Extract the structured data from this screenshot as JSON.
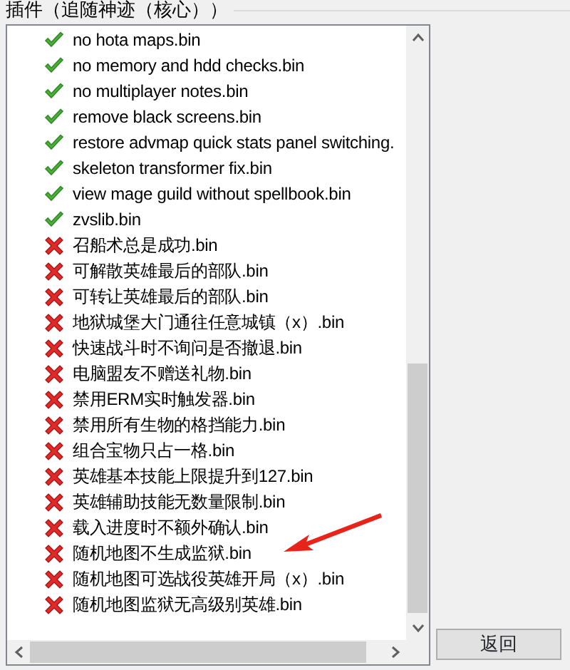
{
  "group_title": "插件（追随神迹（核心））",
  "plugins": [
    {
      "name": "no hota maps.bin",
      "checked": true
    },
    {
      "name": "no memory and hdd checks.bin",
      "checked": true
    },
    {
      "name": "no multiplayer notes.bin",
      "checked": true
    },
    {
      "name": "remove black screens.bin",
      "checked": true
    },
    {
      "name": "restore advmap quick stats panel switching.",
      "checked": true
    },
    {
      "name": "skeleton transformer fix.bin",
      "checked": true
    },
    {
      "name": "view mage guild without spellbook.bin",
      "checked": true
    },
    {
      "name": "zvslib.bin",
      "checked": true
    },
    {
      "name": "召船术总是成功.bin",
      "checked": false
    },
    {
      "name": "可解散英雄最后的部队.bin",
      "checked": false
    },
    {
      "name": "可转让英雄最后的部队.bin",
      "checked": false
    },
    {
      "name": "地狱城堡大门通往任意城镇（x）.bin",
      "checked": false
    },
    {
      "name": "快速战斗时不询问是否撤退.bin",
      "checked": false
    },
    {
      "name": "电脑盟友不赠送礼物.bin",
      "checked": false
    },
    {
      "name": "禁用ERM实时触发器.bin",
      "checked": false
    },
    {
      "name": "禁用所有生物的格挡能力.bin",
      "checked": false
    },
    {
      "name": "组合宝物只占一格.bin",
      "checked": false
    },
    {
      "name": "英雄基本技能上限提升到127.bin",
      "checked": false
    },
    {
      "name": "英雄辅助技能无数量限制.bin",
      "checked": false
    },
    {
      "name": "载入进度时不额外确认.bin",
      "checked": false
    },
    {
      "name": "随机地图不生成监狱.bin",
      "checked": false
    },
    {
      "name": "随机地图可选战役英雄开局（x）.bin",
      "checked": false
    },
    {
      "name": "随机地图监狱无高级别英雄.bin",
      "checked": false
    }
  ],
  "back_button": "返回"
}
